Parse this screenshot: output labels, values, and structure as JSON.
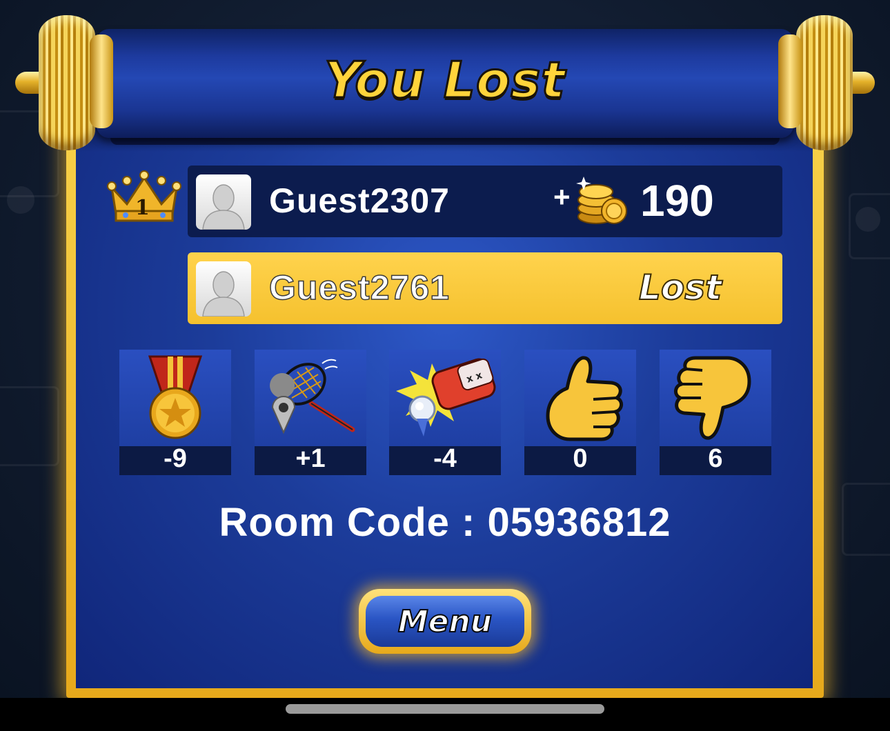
{
  "title": "You Lost",
  "crown": {
    "rank": "1"
  },
  "players": [
    {
      "name": "Guest2307",
      "reward_prefix": "+",
      "reward_amount": "190"
    },
    {
      "name": "Guest2761",
      "status": "Lost"
    }
  ],
  "stats": [
    {
      "icon": "medal-icon",
      "value": "-9"
    },
    {
      "icon": "net-capture-icon",
      "value": "+1"
    },
    {
      "icon": "knocked-out-icon",
      "value": "-4"
    },
    {
      "icon": "thumbs-up-icon",
      "value": "0"
    },
    {
      "icon": "thumbs-down-icon",
      "value": "6"
    }
  ],
  "room_code": "Room Code : 05936812",
  "menu_label": "Menu",
  "colors": {
    "gold": "#ffd43b",
    "panel_blue": "#1c3c9a",
    "row_dark": "#0c1c4e",
    "row_gold": "#f5c12e"
  }
}
